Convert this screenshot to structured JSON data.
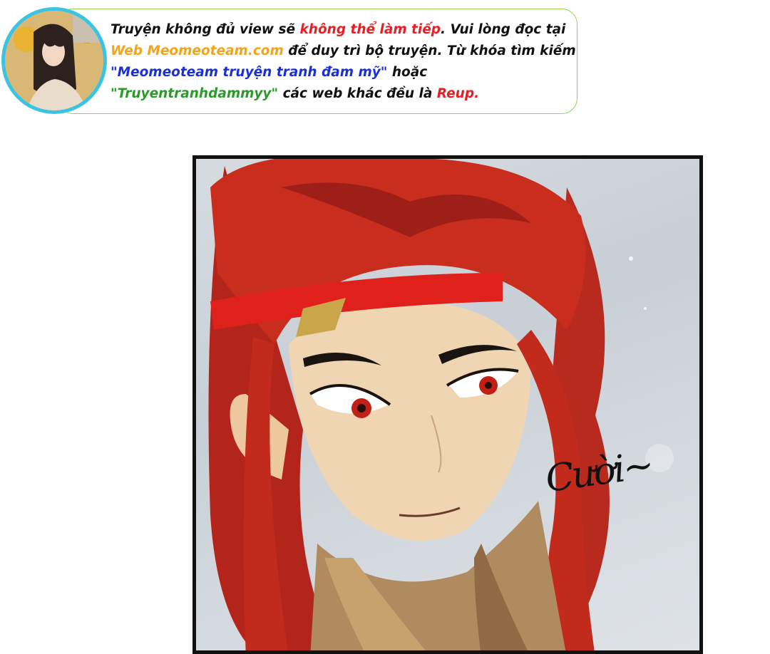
{
  "notice": {
    "line1": [
      {
        "text": "Truyện không đủ view sẽ ",
        "color": "default"
      },
      {
        "text": "không thể làm tiếp",
        "color": "red"
      },
      {
        "text": ". Vui lòng đọc tại",
        "color": "default"
      }
    ],
    "line2": [
      {
        "text": "Web Meomeoteam.com",
        "color": "orange"
      },
      {
        "text": " để duy trì bộ truyện. Từ khóa tìm kiếm",
        "color": "default"
      }
    ],
    "line3": [
      {
        "text": "\"Meomeoteam truyện tranh đam mỹ\"",
        "color": "blue"
      },
      {
        "text": " hoặc",
        "color": "default"
      }
    ],
    "line4": [
      {
        "text": "\"Truyentranhdammyy\"",
        "color": "green"
      },
      {
        "text": " các web khác đều là ",
        "color": "default"
      },
      {
        "text": "Reup.",
        "color": "red"
      }
    ]
  },
  "panel": {
    "sfx_text": "Cười~"
  },
  "colors": {
    "banner_border": "#8fd44a",
    "avatar_ring_top": "#39c4e6",
    "avatar_ring_bottom": "#6ad13f",
    "hair": "#c8281c",
    "headband": "#e0201a"
  }
}
